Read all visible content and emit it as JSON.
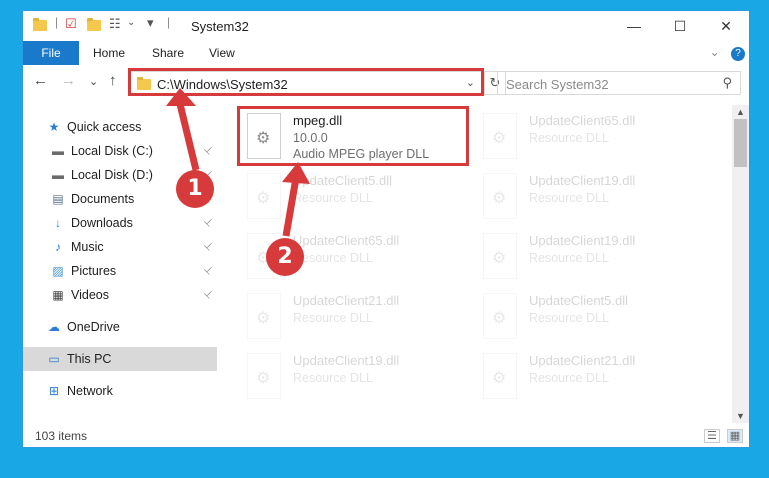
{
  "window": {
    "title": "System32",
    "minimize_label": "—",
    "maximize_label": "☐",
    "close_label": "✕"
  },
  "ribbon": {
    "tabs": [
      "File",
      "Home",
      "Share",
      "View"
    ],
    "expand_label": "⌄",
    "help_label": "?"
  },
  "navbar": {
    "back": "←",
    "forward": "→",
    "recent": "⌄",
    "up": "↑",
    "address": "C:\\Windows\\System32",
    "refresh": "↻",
    "search_placeholder": "Search System32",
    "search_icon": "⚲"
  },
  "sidebar": {
    "items": [
      {
        "label": "Quick access",
        "icon": "star-icon",
        "glyph": "★",
        "color": "#2c7bd8",
        "pinned": false
      },
      {
        "label": "Local Disk (C:)",
        "icon": "disk-icon",
        "glyph": "▬",
        "color": "#6b6b6b",
        "pinned": true
      },
      {
        "label": "Local Disk (D:)",
        "icon": "disk-icon",
        "glyph": "▬",
        "color": "#6b6b6b",
        "pinned": true
      },
      {
        "label": "Documents",
        "icon": "documents-icon",
        "glyph": "▤",
        "color": "#5a6e8a",
        "pinned": true
      },
      {
        "label": "Downloads",
        "icon": "download-icon",
        "glyph": "↓",
        "color": "#2c7bd8",
        "pinned": true
      },
      {
        "label": "Music",
        "icon": "music-icon",
        "glyph": "♪",
        "color": "#2c7bd8",
        "pinned": true
      },
      {
        "label": "Pictures",
        "icon": "pictures-icon",
        "glyph": "▨",
        "color": "#3a8fd8",
        "pinned": true
      },
      {
        "label": "Videos",
        "icon": "videos-icon",
        "glyph": "▦",
        "color": "#444444",
        "pinned": true
      },
      {
        "label": "OneDrive",
        "icon": "cloud-icon",
        "glyph": "☁",
        "color": "#2c7bd8",
        "pinned": false
      },
      {
        "label": "This PC",
        "icon": "computer-icon",
        "glyph": "▭",
        "color": "#2c7bd8",
        "pinned": false
      },
      {
        "label": "Network",
        "icon": "network-icon",
        "glyph": "⊞",
        "color": "#2c7bd8",
        "pinned": false
      }
    ],
    "pin_glyph": "📌"
  },
  "files": [
    {
      "name": "mpeg.dll",
      "line1": "10.0.0",
      "line2": "Audio MPEG player DLL",
      "faded": false
    },
    {
      "name": "UpdateClient65.dll",
      "line1": "Resource DLL",
      "faded": true
    },
    {
      "name": "UpdateClient5.dll",
      "line1": "Resource DLL",
      "faded": true
    },
    {
      "name": "UpdateClient19.dll",
      "line1": "Resource DLL",
      "faded": true
    },
    {
      "name": "UpdateClient65.dll",
      "line1": "Resource DLL",
      "faded": true
    },
    {
      "name": "UpdateClient19.dll",
      "line1": "Resource DLL",
      "faded": true
    },
    {
      "name": "UpdateClient21.dll",
      "line1": "Resource DLL",
      "faded": true
    },
    {
      "name": "UpdateClient5.dll",
      "line1": "Resource DLL",
      "faded": true
    },
    {
      "name": "UpdateClient19.dll",
      "line1": "Resource DLL",
      "faded": true
    },
    {
      "name": "UpdateClient21.dll",
      "line1": "Resource DLL",
      "faded": true
    }
  ],
  "status": {
    "count": "103 items"
  },
  "annotations": {
    "marker1": "1",
    "marker2": "2",
    "color": "#d63a3a"
  }
}
